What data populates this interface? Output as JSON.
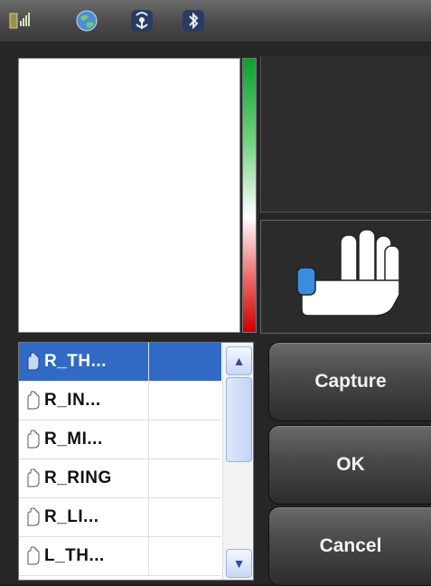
{
  "status_bar": {
    "icons": [
      "signal-icon",
      "globe-icon",
      "wireless-icon",
      "bluetooth-icon"
    ]
  },
  "finger_list": {
    "items": [
      {
        "label": "R_TH...",
        "selected": true
      },
      {
        "label": "R_IN...",
        "selected": false
      },
      {
        "label": "R_MI...",
        "selected": false
      },
      {
        "label": "R_RING",
        "selected": false
      },
      {
        "label": "R_LI...",
        "selected": false
      },
      {
        "label": "L_TH...",
        "selected": false
      }
    ]
  },
  "buttons": {
    "capture": "Capture",
    "ok": "OK",
    "cancel": "Cancel"
  },
  "colors": {
    "selection": "#316ac5",
    "meter_top": "#0aa12e",
    "meter_bottom": "#cc0000",
    "highlight_finger": "#3a8dde"
  }
}
